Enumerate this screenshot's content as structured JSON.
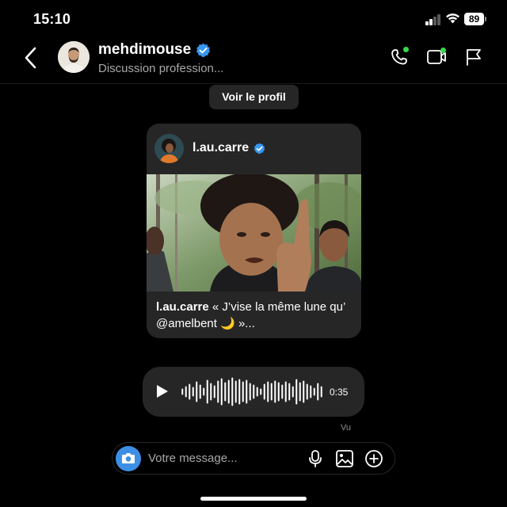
{
  "status_bar": {
    "time": "15:10",
    "battery": "89",
    "signal_bars_active": 2,
    "signal_bars_total": 4
  },
  "header": {
    "username": "mehdimouse",
    "verified": true,
    "subtitle": "Discussion profession...",
    "icons": [
      "chevron-left-icon",
      "phone-icon",
      "video-camera-icon",
      "flag-icon"
    ],
    "call_active_color": "#35d94a"
  },
  "profile_button": {
    "label": "Voir le profil"
  },
  "shared_post": {
    "author": "l.au.carre",
    "verified": true,
    "caption_author": "l.au.carre",
    "caption_text": " « J’vise la même lune qu’ @amelbent 🌙 »..."
  },
  "voice_message": {
    "duration": "0:35",
    "icons": [
      "play-icon",
      "waveform-icon"
    ]
  },
  "seen_label": "Vu",
  "composer": {
    "placeholder": "Votre message...",
    "icons": [
      "camera-icon",
      "microphone-icon",
      "gallery-icon",
      "add-circle-icon"
    ]
  },
  "colors": {
    "background": "#000000",
    "bubble": "#262626",
    "verified_badge": "#3897f0",
    "camera_button": "#3d8fe6",
    "secondary_text": "#a8a8a8"
  }
}
